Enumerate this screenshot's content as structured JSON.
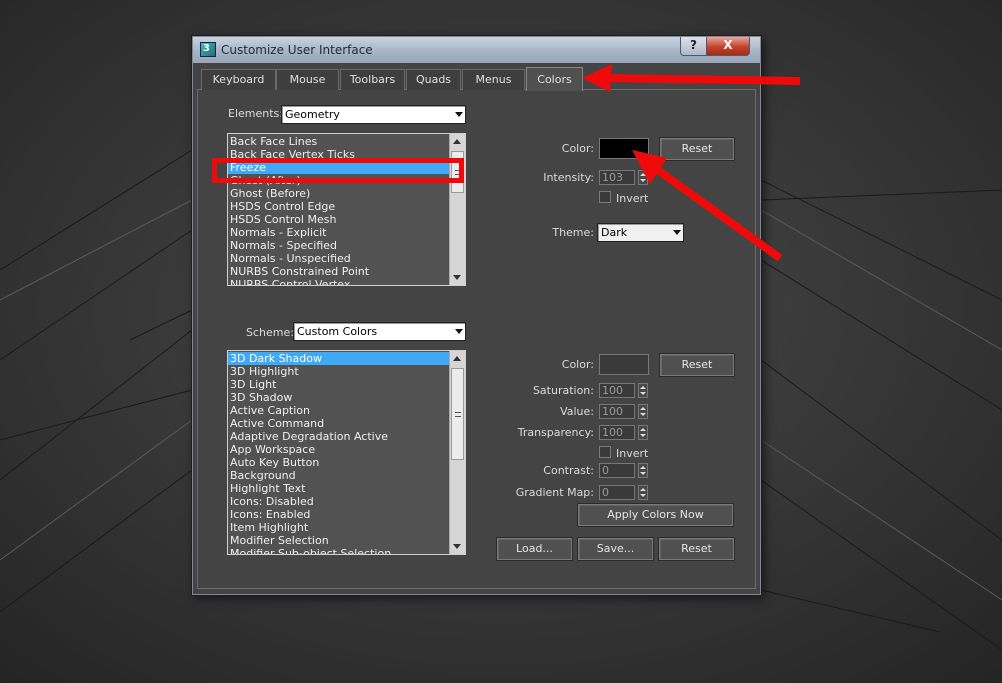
{
  "window": {
    "title": "Customize User Interface",
    "logo_text": "3",
    "help_glyph": "?",
    "close_glyph": "X"
  },
  "tabs": [
    {
      "label": "Keyboard",
      "active": false
    },
    {
      "label": "Mouse",
      "active": false
    },
    {
      "label": "Toolbars",
      "active": false
    },
    {
      "label": "Quads",
      "active": false
    },
    {
      "label": "Menus",
      "active": false
    },
    {
      "label": "Colors",
      "active": true
    }
  ],
  "elements_section": {
    "label": "Elements:",
    "selected": "Geometry",
    "items": [
      {
        "label": "Back Face Lines",
        "selected": false
      },
      {
        "label": "Back Face Vertex Ticks",
        "selected": false
      },
      {
        "label": "Freeze",
        "selected": true
      },
      {
        "label": "Ghost (After)",
        "selected": false
      },
      {
        "label": "Ghost (Before)",
        "selected": false
      },
      {
        "label": "HSDS Control Edge",
        "selected": false
      },
      {
        "label": "HSDS Control Mesh",
        "selected": false
      },
      {
        "label": "Normals - Explicit",
        "selected": false
      },
      {
        "label": "Normals - Specified",
        "selected": false
      },
      {
        "label": "Normals - Unspecified",
        "selected": false
      },
      {
        "label": "NURBS Constrained Point",
        "selected": false
      },
      {
        "label": "NURBS Control Vertex",
        "selected": false
      }
    ]
  },
  "element_color": {
    "color_label": "Color:",
    "color_value": "#000000",
    "reset_label": "Reset",
    "intensity_label": "Intensity:",
    "intensity_value": "103",
    "invert_label": "Invert",
    "theme_label": "Theme:",
    "theme_value": "Dark"
  },
  "scheme_section": {
    "label": "Scheme:",
    "selected": "Custom Colors",
    "items": [
      {
        "label": "3D Dark Shadow",
        "selected": true
      },
      {
        "label": "3D Highlight",
        "selected": false
      },
      {
        "label": "3D Light",
        "selected": false
      },
      {
        "label": "3D Shadow",
        "selected": false
      },
      {
        "label": "Active Caption",
        "selected": false
      },
      {
        "label": "Active Command",
        "selected": false
      },
      {
        "label": "Adaptive Degradation Active",
        "selected": false
      },
      {
        "label": "App Workspace",
        "selected": false
      },
      {
        "label": "Auto Key Button",
        "selected": false
      },
      {
        "label": "Background",
        "selected": false
      },
      {
        "label": "Highlight Text",
        "selected": false
      },
      {
        "label": "Icons: Disabled",
        "selected": false
      },
      {
        "label": "Icons: Enabled",
        "selected": false
      },
      {
        "label": "Item Highlight",
        "selected": false
      },
      {
        "label": "Modifier Selection",
        "selected": false
      },
      {
        "label": "Modifier Sub-object Selection",
        "selected": false
      }
    ]
  },
  "scheme_color": {
    "color_label": "Color:",
    "color_value": "#3a3a3a",
    "reset_label": "Reset",
    "saturation_label": "Saturation:",
    "saturation_value": "100",
    "value_label": "Value:",
    "value_value": "100",
    "transparency_label": "Transparency:",
    "transparency_value": "100",
    "invert_label": "Invert",
    "contrast_label": "Contrast:",
    "contrast_value": "0",
    "gradient_label": "Gradient Map:",
    "gradient_value": "0",
    "apply_label": "Apply Colors Now"
  },
  "footer": {
    "load_label": "Load...",
    "save_label": "Save...",
    "reset_label": "Reset"
  },
  "annotation_color": "#ee0a0a"
}
